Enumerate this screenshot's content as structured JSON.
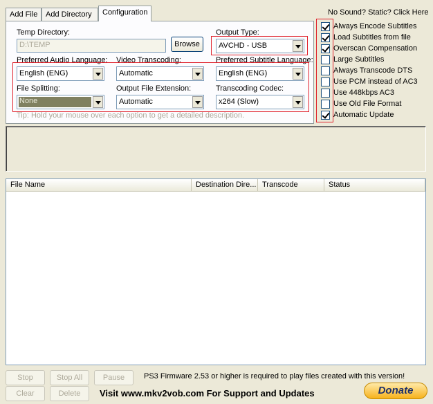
{
  "tabs": [
    {
      "label": "Add File"
    },
    {
      "label": "Add Directory"
    },
    {
      "label": "Configuration"
    }
  ],
  "help_link": "No Sound? Static? Click Here",
  "config": {
    "temp_dir_label": "Temp Directory:",
    "temp_dir_value": "D:\\TEMP",
    "browse_label": "Browse",
    "output_type_label": "Output Type:",
    "output_type_value": "AVCHD - USB",
    "audio_lang_label": "Preferred Audio Language:",
    "audio_lang_value": "English (ENG)",
    "video_transcoding_label": "Video Transcoding:",
    "video_transcoding_value": "Automatic",
    "subtitle_lang_label": "Preferred Subtitle Language:",
    "subtitle_lang_value": "English (ENG)",
    "file_splitting_label": "File Splitting:",
    "file_splitting_value": "None",
    "output_ext_label": "Output File Extension:",
    "output_ext_value": "Automatic",
    "codec_label": "Transcoding Codec:",
    "codec_value": "x264 (Slow)",
    "tip": "Tip: Hold your mouse over each option to get a detailed description."
  },
  "options": [
    {
      "label": "Always Encode Subtitles",
      "checked": true
    },
    {
      "label": "Load Subtitles from file",
      "checked": true
    },
    {
      "label": "Overscan Compensation",
      "checked": true
    },
    {
      "label": "Large Subtitles",
      "checked": false
    },
    {
      "label": "Always Transcode DTS",
      "checked": false
    },
    {
      "label": "Use PCM instead of AC3",
      "checked": false
    },
    {
      "label": "Use 448kbps AC3",
      "checked": false
    },
    {
      "label": "Use Old File Format",
      "checked": false
    },
    {
      "label": "Automatic Update",
      "checked": true
    }
  ],
  "file_list": {
    "columns": [
      "File Name",
      "Destination Dire...",
      "Transcode",
      "Status"
    ],
    "rows": []
  },
  "controls": {
    "stop": "Stop",
    "stop_all": "Stop All",
    "pause": "Pause",
    "clear": "Clear",
    "delete": "Delete"
  },
  "firmware_note": "PS3 Firmware 2.53 or higher is required to play files created with this version!",
  "support_text": "Visit www.mkv2vob.com For Support and Updates",
  "donate_label": "Donate",
  "colors": {
    "highlight_box": "#e0202a",
    "window_bg": "#ece9d8"
  }
}
